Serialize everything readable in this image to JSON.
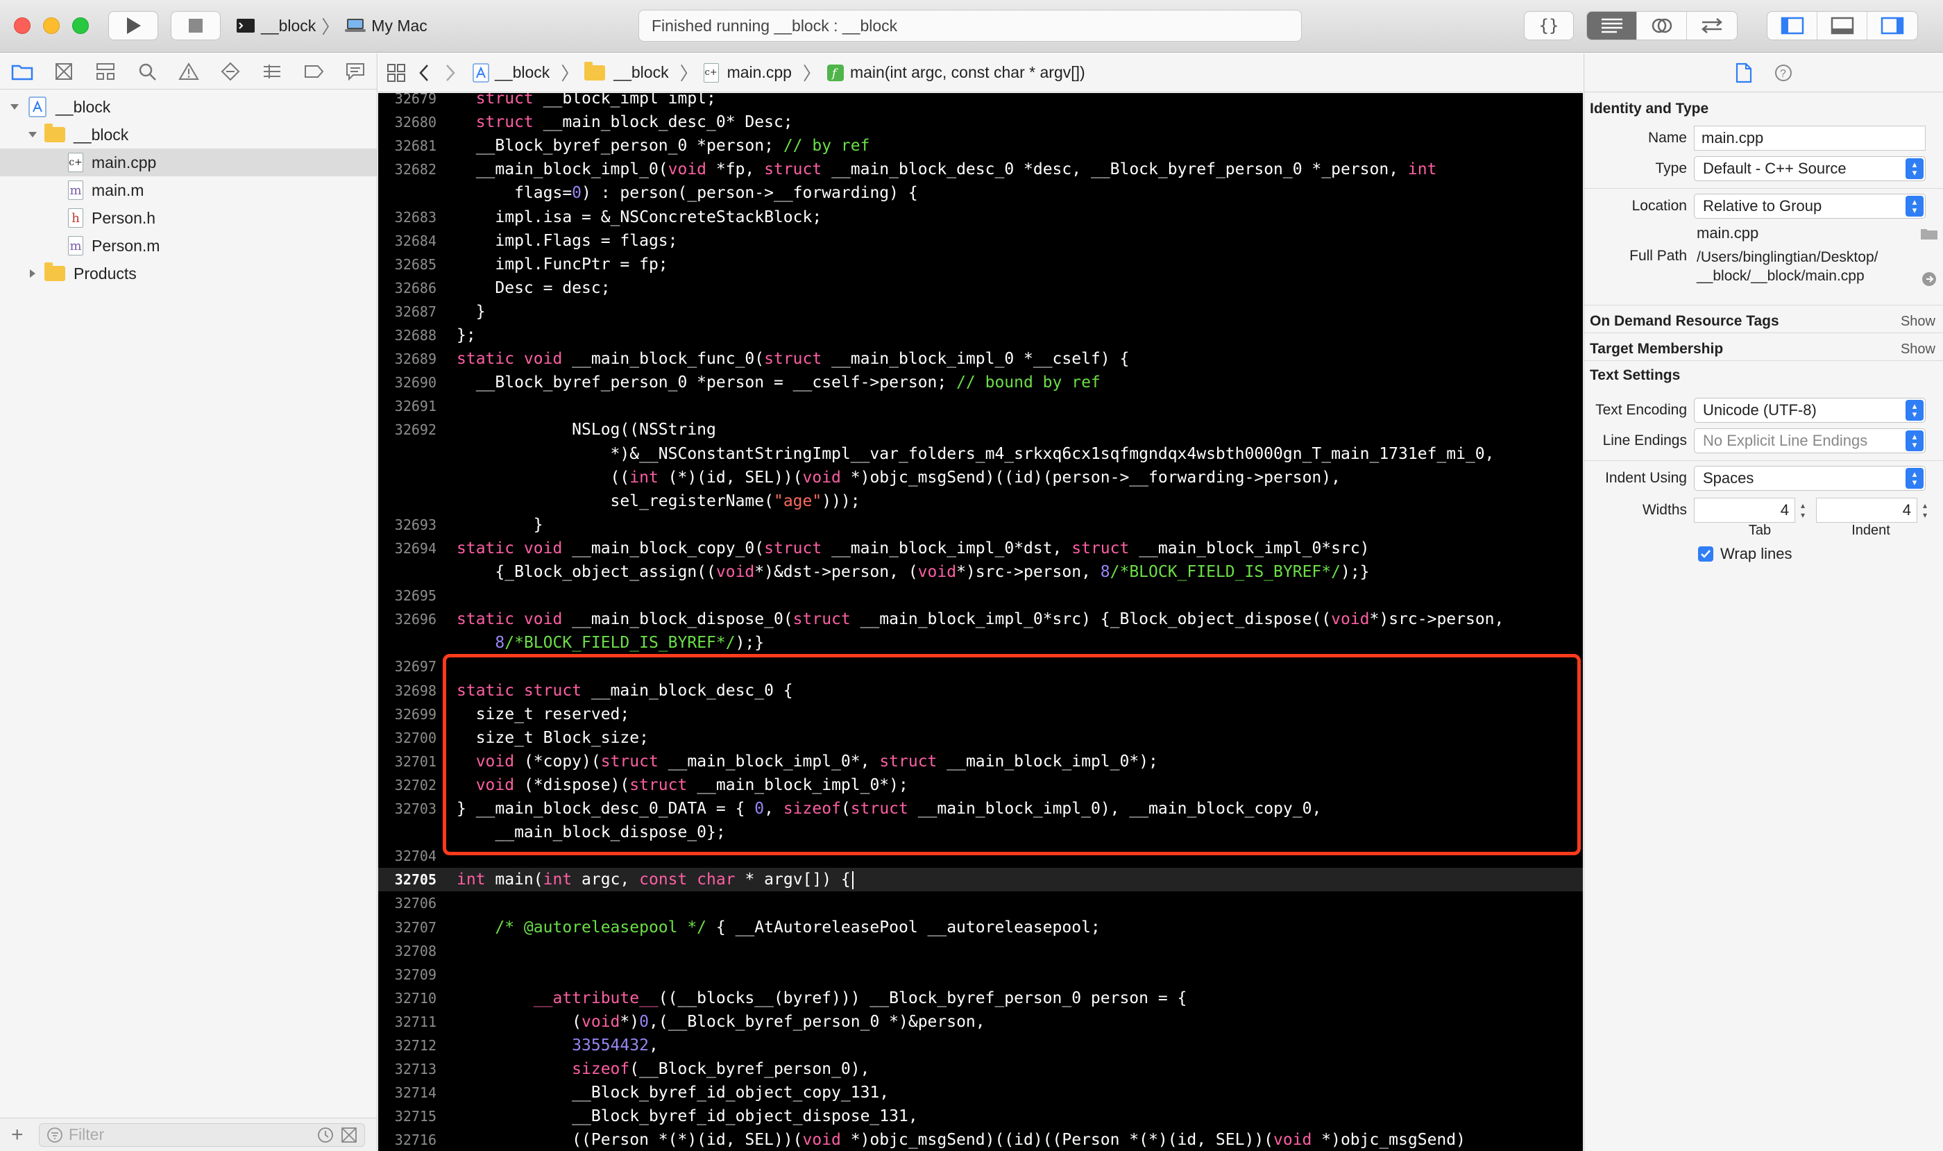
{
  "toolbar": {
    "scheme": "__block",
    "destination": "My Mac",
    "status": "Finished running __block : __block",
    "braces_label": "{}"
  },
  "navigator": {
    "items": [
      {
        "label": "__block",
        "kind": "project",
        "depth": 0,
        "expanded": true
      },
      {
        "label": "__block",
        "kind": "folder",
        "depth": 1,
        "expanded": true
      },
      {
        "label": "main.cpp",
        "kind": "cpp",
        "depth": 2,
        "selected": true,
        "glyph": "c+"
      },
      {
        "label": "main.m",
        "kind": "m",
        "depth": 2,
        "glyph": "m"
      },
      {
        "label": "Person.h",
        "kind": "h",
        "depth": 2,
        "glyph": "h"
      },
      {
        "label": "Person.m",
        "kind": "m",
        "depth": 2,
        "glyph": "m"
      },
      {
        "label": "Products",
        "kind": "folder",
        "depth": 1,
        "expanded": false
      }
    ],
    "filter_placeholder": "Filter",
    "add_label": "+"
  },
  "jumpbar": {
    "crumbs": [
      "__block",
      "__block",
      "main.cpp",
      "main(int argc, const char * argv[])"
    ]
  },
  "editor": {
    "current_line": "32705",
    "lines": [
      {
        "n": "32679",
        "t": [
          [
            "k",
            "  struct"
          ],
          [
            "p",
            " __block_impl impl;"
          ]
        ]
      },
      {
        "n": "32680",
        "t": [
          [
            "k",
            "  struct"
          ],
          [
            "p",
            " __main_block_desc_0* Desc;"
          ]
        ]
      },
      {
        "n": "32681",
        "t": [
          [
            "p",
            "  __Block_byref_person_0 *person; "
          ],
          [
            "c",
            "// by ref"
          ]
        ]
      },
      {
        "n": "32682",
        "t": [
          [
            "p",
            "  __main_block_impl_0("
          ],
          [
            "k",
            "void"
          ],
          [
            "p",
            " *fp, "
          ],
          [
            "k",
            "struct"
          ],
          [
            "p",
            " __main_block_desc_0 *desc, __Block_byref_person_0 *_person, "
          ],
          [
            "k",
            "int"
          ]
        ]
      },
      {
        "n": "",
        "t": [
          [
            "p",
            "      flags="
          ],
          [
            "n",
            "0"
          ],
          [
            "p",
            ") : person(_person->__forwarding) {"
          ]
        ]
      },
      {
        "n": "32683",
        "t": [
          [
            "p",
            "    impl.isa = &_NSConcreteStackBlock;"
          ]
        ]
      },
      {
        "n": "32684",
        "t": [
          [
            "p",
            "    impl.Flags = flags;"
          ]
        ]
      },
      {
        "n": "32685",
        "t": [
          [
            "p",
            "    impl.FuncPtr = fp;"
          ]
        ]
      },
      {
        "n": "32686",
        "t": [
          [
            "p",
            "    Desc = desc;"
          ]
        ]
      },
      {
        "n": "32687",
        "t": [
          [
            "p",
            "  }"
          ]
        ]
      },
      {
        "n": "32688",
        "t": [
          [
            "p",
            "};"
          ]
        ]
      },
      {
        "n": "32689",
        "t": [
          [
            "k",
            "static void"
          ],
          [
            "p",
            " __main_block_func_0("
          ],
          [
            "k",
            "struct"
          ],
          [
            "p",
            " __main_block_impl_0 *__cself) {"
          ]
        ]
      },
      {
        "n": "32690",
        "t": [
          [
            "p",
            "  __Block_byref_person_0 *person = __cself->person; "
          ],
          [
            "c",
            "// bound by ref"
          ]
        ]
      },
      {
        "n": "32691",
        "t": [
          [
            "p",
            ""
          ]
        ]
      },
      {
        "n": "32692",
        "t": [
          [
            "p",
            "            NSLog((NSString"
          ]
        ]
      },
      {
        "n": "",
        "t": [
          [
            "p",
            "                *)&__NSConstantStringImpl__var_folders_m4_srkxq6cx1sqfmgndqx4wsbth0000gn_T_main_1731ef_mi_0,"
          ]
        ]
      },
      {
        "n": "",
        "t": [
          [
            "p",
            "                (("
          ],
          [
            "k",
            "int"
          ],
          [
            "p",
            " (*)(id, SEL))("
          ],
          [
            "k",
            "void"
          ],
          [
            "p",
            " *)objc_msgSend)((id)(person->__forwarding->person),"
          ]
        ]
      },
      {
        "n": "",
        "t": [
          [
            "p",
            "                sel_registerName("
          ],
          [
            "s",
            "\"age\""
          ],
          [
            "p",
            ")));"
          ]
        ]
      },
      {
        "n": "32693",
        "t": [
          [
            "p",
            "        }"
          ]
        ]
      },
      {
        "n": "32694",
        "t": [
          [
            "k",
            "static void"
          ],
          [
            "p",
            " __main_block_copy_0("
          ],
          [
            "k",
            "struct"
          ],
          [
            "p",
            " __main_block_impl_0*dst, "
          ],
          [
            "k",
            "struct"
          ],
          [
            "p",
            " __main_block_impl_0*src)"
          ]
        ]
      },
      {
        "n": "",
        "t": [
          [
            "p",
            "    {_Block_object_assign(("
          ],
          [
            "k",
            "void"
          ],
          [
            "p",
            "*)&dst->person, ("
          ],
          [
            "k",
            "void"
          ],
          [
            "p",
            "*)src->person, "
          ],
          [
            "n",
            "8"
          ],
          [
            "c",
            "/*BLOCK_FIELD_IS_BYREF*/"
          ],
          [
            "p",
            ");}"
          ]
        ]
      },
      {
        "n": "32695",
        "t": [
          [
            "p",
            ""
          ]
        ]
      },
      {
        "n": "32696",
        "t": [
          [
            "k",
            "static void"
          ],
          [
            "p",
            " __main_block_dispose_0("
          ],
          [
            "k",
            "struct"
          ],
          [
            "p",
            " __main_block_impl_0*src) {_Block_object_dispose(("
          ],
          [
            "k",
            "void"
          ],
          [
            "p",
            "*)src->person,"
          ]
        ]
      },
      {
        "n": "",
        "t": [
          [
            "p",
            "    "
          ],
          [
            "n",
            "8"
          ],
          [
            "c",
            "/*BLOCK_FIELD_IS_BYREF*/"
          ],
          [
            "p",
            ");}"
          ]
        ]
      },
      {
        "n": "32697",
        "t": [
          [
            "p",
            ""
          ]
        ]
      },
      {
        "n": "32698",
        "t": [
          [
            "k",
            "static struct"
          ],
          [
            "p",
            " __main_block_desc_0 {"
          ]
        ]
      },
      {
        "n": "32699",
        "t": [
          [
            "p",
            "  size_t reserved;"
          ]
        ]
      },
      {
        "n": "32700",
        "t": [
          [
            "p",
            "  size_t Block_size;"
          ]
        ]
      },
      {
        "n": "32701",
        "t": [
          [
            "k",
            "  void"
          ],
          [
            "p",
            " (*copy)("
          ],
          [
            "k",
            "struct"
          ],
          [
            "p",
            " __main_block_impl_0*, "
          ],
          [
            "k",
            "struct"
          ],
          [
            "p",
            " __main_block_impl_0*);"
          ]
        ]
      },
      {
        "n": "32702",
        "t": [
          [
            "k",
            "  void"
          ],
          [
            "p",
            " (*dispose)("
          ],
          [
            "k",
            "struct"
          ],
          [
            "p",
            " __main_block_impl_0*);"
          ]
        ]
      },
      {
        "n": "32703",
        "t": [
          [
            "p",
            "} __main_block_desc_0_DATA = { "
          ],
          [
            "n",
            "0"
          ],
          [
            "p",
            ", "
          ],
          [
            "k",
            "sizeof"
          ],
          [
            "p",
            "("
          ],
          [
            "k",
            "struct"
          ],
          [
            "p",
            " __main_block_impl_0), __main_block_copy_0,"
          ]
        ]
      },
      {
        "n": "",
        "t": [
          [
            "p",
            "    __main_block_dispose_0};"
          ]
        ]
      },
      {
        "n": "32704",
        "t": [
          [
            "p",
            ""
          ]
        ]
      },
      {
        "n": "32705",
        "t": [
          [
            "k",
            "int"
          ],
          [
            "p",
            " main("
          ],
          [
            "k",
            "int"
          ],
          [
            "p",
            " argc, "
          ],
          [
            "k",
            "const char"
          ],
          [
            "p",
            " * argv[]) {"
          ]
        ]
      },
      {
        "n": "32706",
        "t": [
          [
            "p",
            ""
          ]
        ]
      },
      {
        "n": "32707",
        "t": [
          [
            "p",
            "    "
          ],
          [
            "c",
            "/* @autoreleasepool */"
          ],
          [
            "p",
            " { __AtAutoreleasePool __autoreleasepool;"
          ]
        ]
      },
      {
        "n": "32708",
        "t": [
          [
            "p",
            ""
          ]
        ]
      },
      {
        "n": "32709",
        "t": [
          [
            "p",
            ""
          ]
        ]
      },
      {
        "n": "32710",
        "t": [
          [
            "p",
            "        "
          ],
          [
            "k",
            "__attribute__"
          ],
          [
            "p",
            "((__blocks__(byref))) __Block_byref_person_0 person = {"
          ]
        ]
      },
      {
        "n": "32711",
        "t": [
          [
            "p",
            "            ("
          ],
          [
            "k",
            "void"
          ],
          [
            "p",
            "*)"
          ],
          [
            "n",
            "0"
          ],
          [
            "p",
            ",(__Block_byref_person_0 *)&person,"
          ]
        ]
      },
      {
        "n": "32712",
        "t": [
          [
            "p",
            "            "
          ],
          [
            "n",
            "33554432"
          ],
          [
            "p",
            ","
          ]
        ]
      },
      {
        "n": "32713",
        "t": [
          [
            "k",
            "            sizeof"
          ],
          [
            "p",
            "(__Block_byref_person_0),"
          ]
        ]
      },
      {
        "n": "32714",
        "t": [
          [
            "p",
            "            __Block_byref_id_object_copy_131,"
          ]
        ]
      },
      {
        "n": "32715",
        "t": [
          [
            "p",
            "            __Block_byref_id_object_dispose_131,"
          ]
        ]
      },
      {
        "n": "32716",
        "t": [
          [
            "p",
            "            ((Person *(*)(id, SEL))("
          ],
          [
            "k",
            "void"
          ],
          [
            "p",
            " *)objc_msgSend)((id)((Person *(*)(id, SEL))("
          ],
          [
            "k",
            "void"
          ],
          [
            "p",
            " *)objc_msgSend)"
          ]
        ]
      }
    ]
  },
  "inspector": {
    "identity_title": "Identity and Type",
    "name_label": "Name",
    "name_value": "main.cpp",
    "type_label": "Type",
    "type_value": "Default - C++ Source",
    "location_label": "Location",
    "location_value": "Relative to Group",
    "location_file": "main.cpp",
    "fullpath_label": "Full Path",
    "fullpath_line1": "/Users/binglingtian/Desktop/",
    "fullpath_line2": "__block/__block/main.cpp",
    "odr_title": "On Demand Resource Tags",
    "odr_show": "Show",
    "target_title": "Target Membership",
    "target_show": "Show",
    "text_title": "Text Settings",
    "encoding_label": "Text Encoding",
    "encoding_value": "Unicode (UTF-8)",
    "endings_label": "Line Endings",
    "endings_value": "No Explicit Line Endings",
    "indent_label": "Indent Using",
    "indent_value": "Spaces",
    "widths_label": "Widths",
    "tab_value": "4",
    "tab_caption": "Tab",
    "indent_width_value": "4",
    "indent_caption": "Indent",
    "wrap_label": "Wrap lines"
  }
}
